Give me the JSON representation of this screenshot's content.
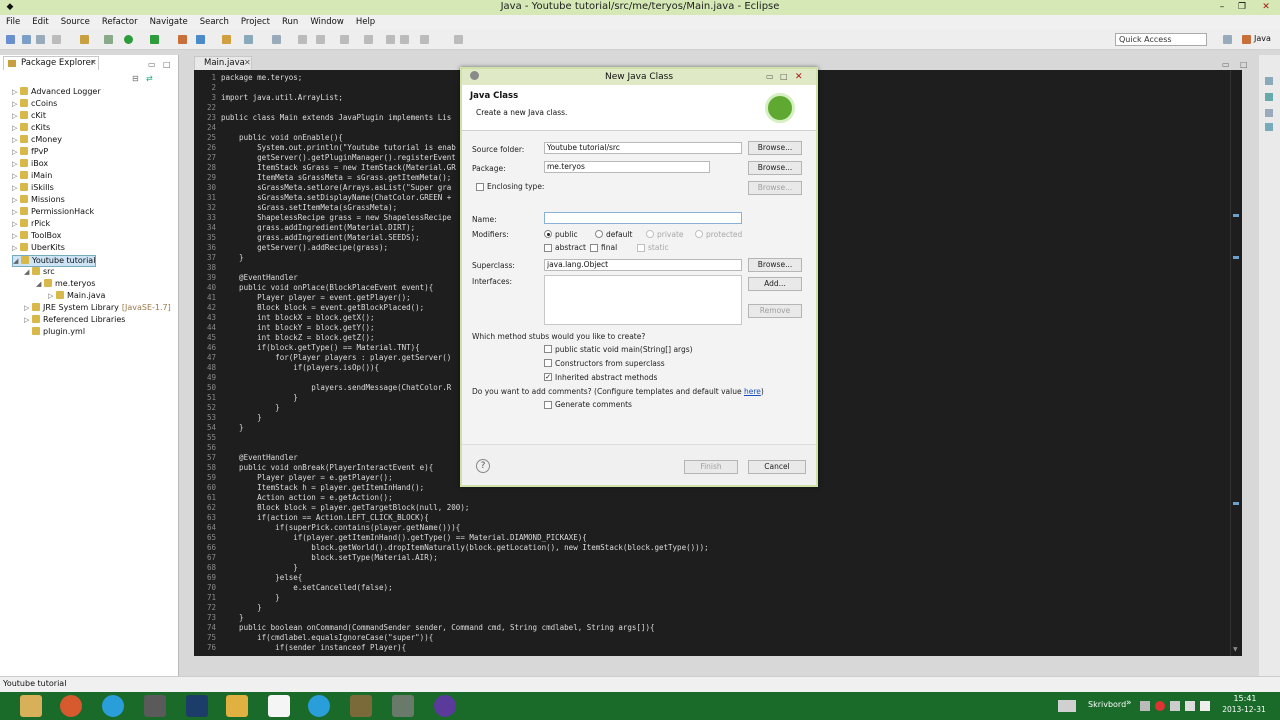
{
  "window": {
    "title": "Java - Youtube tutorial/src/me/teryos/Main.java - Eclipse"
  },
  "menu": [
    "File",
    "Edit",
    "Source",
    "Refactor",
    "Navigate",
    "Search",
    "Project",
    "Run",
    "Window",
    "Help"
  ],
  "toolbar": {
    "quick_access": "Quick Access",
    "perspective": "Java"
  },
  "package_explorer": {
    "tab": "Package Explorer",
    "items": [
      {
        "label": "Advanced Logger",
        "level": 0,
        "arrow": "▷"
      },
      {
        "label": "cCoins",
        "level": 0,
        "arrow": "▷"
      },
      {
        "label": "cKit",
        "level": 0,
        "arrow": "▷"
      },
      {
        "label": "cKits",
        "level": 0,
        "arrow": "▷"
      },
      {
        "label": "cMoney",
        "level": 0,
        "arrow": "▷"
      },
      {
        "label": "fPvP",
        "level": 0,
        "arrow": "▷"
      },
      {
        "label": "iBox",
        "level": 0,
        "arrow": "▷"
      },
      {
        "label": "iMain",
        "level": 0,
        "arrow": "▷"
      },
      {
        "label": "iSkills",
        "level": 0,
        "arrow": "▷"
      },
      {
        "label": "Missions",
        "level": 0,
        "arrow": "▷"
      },
      {
        "label": "PermissionHack",
        "level": 0,
        "arrow": "▷"
      },
      {
        "label": "rPick",
        "level": 0,
        "arrow": "▷"
      },
      {
        "label": "ToolBox",
        "level": 0,
        "arrow": "▷"
      },
      {
        "label": "UberKits",
        "level": 0,
        "arrow": "▷"
      },
      {
        "label": "Youtube tutorial",
        "level": 0,
        "arrow": "◢",
        "selected": true
      },
      {
        "label": "src",
        "level": 1,
        "arrow": "◢"
      },
      {
        "label": "me.teryos",
        "level": 2,
        "arrow": "◢"
      },
      {
        "label": "Main.java",
        "level": 3,
        "arrow": "▷"
      },
      {
        "label": "JRE System Library",
        "level": 1,
        "arrow": "▷",
        "suffix": "[JavaSE-1.7]"
      },
      {
        "label": "Referenced Libraries",
        "level": 1,
        "arrow": "▷"
      },
      {
        "label": "plugin.yml",
        "level": 1,
        "arrow": ""
      }
    ]
  },
  "editor": {
    "tab": "Main.java",
    "lines": [
      {
        "n": "1",
        "t": "package me.teryos;"
      },
      {
        "n": "2",
        "t": ""
      },
      {
        "n": "3",
        "t": "import java.util.ArrayList;"
      },
      {
        "n": "22",
        "t": ""
      },
      {
        "n": "23",
        "t": "public class Main extends JavaPlugin implements Lis"
      },
      {
        "n": "24",
        "t": ""
      },
      {
        "n": "25",
        "t": "    public void onEnable(){"
      },
      {
        "n": "26",
        "t": "        System.out.println(\"Youtube tutorial is enab"
      },
      {
        "n": "27",
        "t": "        getServer().getPluginManager().registerEvent"
      },
      {
        "n": "28",
        "t": "        ItemStack sGrass = new ItemStack(Material.GR"
      },
      {
        "n": "29",
        "t": "        ItemMeta sGrassMeta = sGrass.getItemMeta();"
      },
      {
        "n": "30",
        "t": "        sGrassMeta.setLore(Arrays.asList(\"Super gra"
      },
      {
        "n": "31",
        "t": "        sGrassMeta.setDisplayName(ChatColor.GREEN + "
      },
      {
        "n": "32",
        "t": "        sGrass.setItemMeta(sGrassMeta);"
      },
      {
        "n": "33",
        "t": "        ShapelessRecipe grass = new ShapelessRecipe"
      },
      {
        "n": "34",
        "t": "        grass.addIngredient(Material.DIRT);"
      },
      {
        "n": "35",
        "t": "        grass.addIngredient(Material.SEEDS);"
      },
      {
        "n": "36",
        "t": "        getServer().addRecipe(grass);"
      },
      {
        "n": "37",
        "t": "    }"
      },
      {
        "n": "38",
        "t": ""
      },
      {
        "n": "39",
        "t": "    @EventHandler"
      },
      {
        "n": "40",
        "t": "    public void onPlace(BlockPlaceEvent event){"
      },
      {
        "n": "41",
        "t": "        Player player = event.getPlayer();"
      },
      {
        "n": "42",
        "t": "        Block block = event.getBlockPlaced();"
      },
      {
        "n": "43",
        "t": "        int blockX = block.getX();"
      },
      {
        "n": "44",
        "t": "        int blockY = block.getY();"
      },
      {
        "n": "45",
        "t": "        int blockZ = block.getZ();"
      },
      {
        "n": "46",
        "t": "        if(block.getType() == Material.TNT){"
      },
      {
        "n": "47",
        "t": "            for(Player players : player.getServer()"
      },
      {
        "n": "48",
        "t": "                if(players.isOp()){"
      },
      {
        "n": "49",
        "t": ""
      },
      {
        "n": "50",
        "t": "                    players.sendMessage(ChatColor.R                                                 \" blockY + \" \" + block2);"
      },
      {
        "n": "51",
        "t": "                }"
      },
      {
        "n": "52",
        "t": "            }"
      },
      {
        "n": "53",
        "t": "        }"
      },
      {
        "n": "54",
        "t": "    }"
      },
      {
        "n": "55",
        "t": ""
      },
      {
        "n": "56",
        "t": ""
      },
      {
        "n": "57",
        "t": "    @EventHandler"
      },
      {
        "n": "58",
        "t": "    public void onBreak(PlayerInteractEvent e){"
      },
      {
        "n": "59",
        "t": "        Player player = e.getPlayer();"
      },
      {
        "n": "60",
        "t": "        ItemStack h = player.getItemInHand();"
      },
      {
        "n": "61",
        "t": "        Action action = e.getAction();"
      },
      {
        "n": "62",
        "t": "        Block block = player.getTargetBlock(null, 200);"
      },
      {
        "n": "63",
        "t": "        if(action == Action.LEFT_CLICK_BLOCK){"
      },
      {
        "n": "64",
        "t": "            if(superPick.contains(player.getName())){"
      },
      {
        "n": "65",
        "t": "                if(player.getItemInHand().getType() == Material.DIAMOND_PICKAXE){"
      },
      {
        "n": "66",
        "t": "                    block.getWorld().dropItemNaturally(block.getLocation(), new ItemStack(block.getType()));"
      },
      {
        "n": "67",
        "t": "                    block.setType(Material.AIR);"
      },
      {
        "n": "68",
        "t": "                }"
      },
      {
        "n": "69",
        "t": "            }else{"
      },
      {
        "n": "70",
        "t": "                e.setCancelled(false);"
      },
      {
        "n": "71",
        "t": "            }"
      },
      {
        "n": "72",
        "t": "        }"
      },
      {
        "n": "73",
        "t": "    }"
      },
      {
        "n": "74",
        "t": "    public boolean onCommand(CommandSender sender, Command cmd, String cmdlabel, String args[]){"
      },
      {
        "n": "75",
        "t": "        if(cmdlabel.equalsIgnoreCase(\"super\")){"
      },
      {
        "n": "76",
        "t": "            if(sender instanceof Player){"
      }
    ]
  },
  "dialog": {
    "title": "New Java Class",
    "heading": "Java Class",
    "subheading": "Create a new Java class.",
    "source_folder_label": "Source folder:",
    "source_folder_value": "Youtube tutorial/src",
    "package_label": "Package:",
    "package_value": "me.teryos",
    "enclosing_label": "Enclosing type:",
    "name_label": "Name:",
    "name_value": "",
    "modifiers_label": "Modifiers:",
    "mod_public": "public",
    "mod_default": "default",
    "mod_private": "private",
    "mod_protected": "protected",
    "mod_abstract": "abstract",
    "mod_final": "final",
    "mod_static": "static",
    "superclass_label": "Superclass:",
    "superclass_value": "java.lang.Object",
    "interfaces_label": "Interfaces:",
    "browse": "Browse...",
    "add": "Add...",
    "remove": "Remove",
    "stubs_question": "Which method stubs would you like to create?",
    "stub_main": "public static void main(String[] args)",
    "stub_constructors": "Constructors from superclass",
    "stub_inherited": "Inherited abstract methods",
    "comments_question": "Do you want to add comments? (Configure templates and default value ",
    "comments_link": "here",
    "comments_tail": ")",
    "generate_comments": "Generate comments",
    "finish": "Finish",
    "cancel": "Cancel"
  },
  "status": {
    "text": "Youtube tutorial"
  },
  "tray": {
    "lang": "Skrivbord",
    "time": "15:41",
    "date": "2013-12-31"
  }
}
